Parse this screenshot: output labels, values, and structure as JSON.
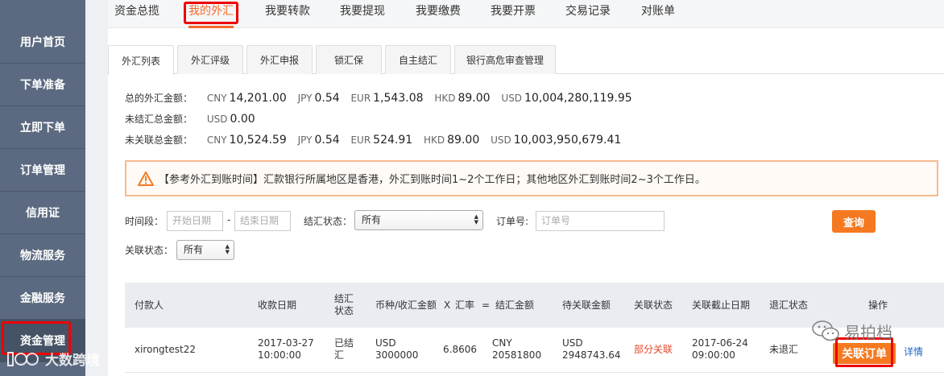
{
  "sidebar": {
    "items": [
      {
        "label": "用户首页"
      },
      {
        "label": "下单准备"
      },
      {
        "label": "立即下单"
      },
      {
        "label": "订单管理"
      },
      {
        "label": "信用证"
      },
      {
        "label": "物流服务"
      },
      {
        "label": "金融服务"
      },
      {
        "label": "资金管理"
      }
    ]
  },
  "topnav": {
    "tabs": [
      {
        "label": "资金总揽"
      },
      {
        "label": "我的外汇"
      },
      {
        "label": "我要转款"
      },
      {
        "label": "我要提现"
      },
      {
        "label": "我要缴费"
      },
      {
        "label": "我要开票"
      },
      {
        "label": "交易记录"
      },
      {
        "label": "对账单"
      }
    ]
  },
  "subtabs": [
    {
      "label": "外汇列表"
    },
    {
      "label": "外汇评级"
    },
    {
      "label": "外汇申报"
    },
    {
      "label": "锁汇保"
    },
    {
      "label": "自主结汇"
    },
    {
      "label": "银行高危审查管理"
    }
  ],
  "summary": {
    "total_label": "总的外汇金额：",
    "total": [
      {
        "cur": "CNY",
        "amt": "14,201.00"
      },
      {
        "cur": "JPY",
        "amt": "0.54"
      },
      {
        "cur": "EUR",
        "amt": "1,543.08"
      },
      {
        "cur": "HKD",
        "amt": "89.00"
      },
      {
        "cur": "USD",
        "amt": "10,004,280,119.95"
      }
    ],
    "unsettled_label": "未结汇总金额：",
    "unsettled": [
      {
        "cur": "USD",
        "amt": "0.00"
      }
    ],
    "unlinked_label": "未关联总金额：",
    "unlinked": [
      {
        "cur": "CNY",
        "amt": "10,524.59"
      },
      {
        "cur": "JPY",
        "amt": "0.54"
      },
      {
        "cur": "EUR",
        "amt": "524.91"
      },
      {
        "cur": "HKD",
        "amt": "89.00"
      },
      {
        "cur": "USD",
        "amt": "10,003,950,679.41"
      }
    ]
  },
  "notice": {
    "icon": "warning-icon",
    "text": "【参考外汇到账时间】汇款银行所属地区是香港，外汇到账时间1~2个工作日；其他地区外汇到账时间2~3个工作日。"
  },
  "filters": {
    "period_label": "时间段：",
    "start_placeholder": "开始日期",
    "dash": "-",
    "end_placeholder": "结束日期",
    "settle_label": "结汇状态：",
    "settle_value": "所有",
    "order_label": "订单号:",
    "order_placeholder": "订单号",
    "query_button": "查询",
    "link_label": "关联状态：",
    "link_value": "所有"
  },
  "table": {
    "headers": {
      "payer": "付款人",
      "date": "收款日期",
      "settle1": "结汇",
      "settle2": "状态",
      "currency": "币种/收汇金额",
      "x": "X",
      "rate": "汇率",
      "eq": "=",
      "settled_amt": "结汇金额",
      "pending": "待关联金额",
      "link_status": "关联状态",
      "deadline": "关联截止日期",
      "refund": "退汇状态",
      "action": "操作"
    },
    "rows": [
      {
        "payer": "xirongtest22",
        "date1": "2017-03-27",
        "date2": "10:00:00",
        "settle1": "已结",
        "settle2": "汇",
        "cur1": "USD",
        "cur2": "3000000",
        "rate": "6.8606",
        "settled1": "CNY",
        "settled2": "20581800",
        "pending1": "USD",
        "pending2": "2948743.64",
        "link_status": "部分关联",
        "deadline1": "2017-06-24",
        "deadline2": "09:00:00",
        "refund": "未退汇",
        "link_button": "关联订单",
        "detail": "详情"
      }
    ]
  },
  "watermarks": {
    "left": "大数跨境",
    "right": "易拍档"
  }
}
